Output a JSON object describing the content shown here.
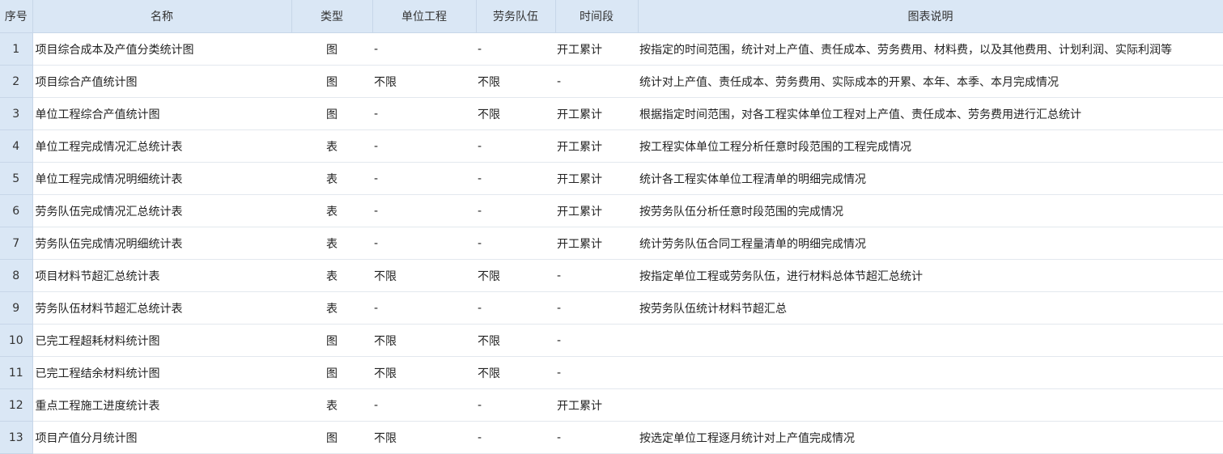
{
  "columns": {
    "idx": "序号",
    "name": "名称",
    "type": "类型",
    "unit": "单位工程",
    "team": "劳务队伍",
    "period": "时间段",
    "desc": "图表说明"
  },
  "rows": [
    {
      "idx": "1",
      "name": "项目综合成本及产值分类统计图",
      "type": "图",
      "unit": "-",
      "team": "-",
      "period": "开工累计",
      "desc": "按指定的时间范围，统计对上产值、责任成本、劳务费用、材料费，以及其他费用、计划利润、实际利润等"
    },
    {
      "idx": "2",
      "name": "项目综合产值统计图",
      "type": "图",
      "unit": "不限",
      "team": "不限",
      "period": "-",
      "desc": "统计对上产值、责任成本、劳务费用、实际成本的开累、本年、本季、本月完成情况"
    },
    {
      "idx": "3",
      "name": "单位工程综合产值统计图",
      "type": "图",
      "unit": "-",
      "team": "不限",
      "period": "开工累计",
      "desc": "根据指定时间范围，对各工程实体单位工程对上产值、责任成本、劳务费用进行汇总统计"
    },
    {
      "idx": "4",
      "name": "单位工程完成情况汇总统计表",
      "type": "表",
      "unit": "-",
      "team": "-",
      "period": "开工累计",
      "desc": "按工程实体单位工程分析任意时段范围的工程完成情况"
    },
    {
      "idx": "5",
      "name": "单位工程完成情况明细统计表",
      "type": "表",
      "unit": "-",
      "team": "-",
      "period": "开工累计",
      "desc": "统计各工程实体单位工程清单的明细完成情况"
    },
    {
      "idx": "6",
      "name": "劳务队伍完成情况汇总统计表",
      "type": "表",
      "unit": "-",
      "team": "-",
      "period": "开工累计",
      "desc": "按劳务队伍分析任意时段范围的完成情况"
    },
    {
      "idx": "7",
      "name": "劳务队伍完成情况明细统计表",
      "type": "表",
      "unit": "-",
      "team": "-",
      "period": "开工累计",
      "desc": "统计劳务队伍合同工程量清单的明细完成情况"
    },
    {
      "idx": "8",
      "name": "项目材料节超汇总统计表",
      "type": "表",
      "unit": "不限",
      "team": "不限",
      "period": "-",
      "desc": "按指定单位工程或劳务队伍，进行材料总体节超汇总统计"
    },
    {
      "idx": "9",
      "name": "劳务队伍材料节超汇总统计表",
      "type": "表",
      "unit": "-",
      "team": "-",
      "period": "-",
      "desc": "按劳务队伍统计材料节超汇总"
    },
    {
      "idx": "10",
      "name": "已完工程超耗材料统计图",
      "type": "图",
      "unit": "不限",
      "team": "不限",
      "period": "-",
      "desc": ""
    },
    {
      "idx": "11",
      "name": "已完工程结余材料统计图",
      "type": "图",
      "unit": "不限",
      "team": "不限",
      "period": "-",
      "desc": ""
    },
    {
      "idx": "12",
      "name": "重点工程施工进度统计表",
      "type": "表",
      "unit": "-",
      "team": "-",
      "period": "开工累计",
      "desc": ""
    },
    {
      "idx": "13",
      "name": "项目产值分月统计图",
      "type": "图",
      "unit": "不限",
      "team": "-",
      "period": "-",
      "desc": "按选定单位工程逐月统计对上产值完成情况"
    }
  ]
}
